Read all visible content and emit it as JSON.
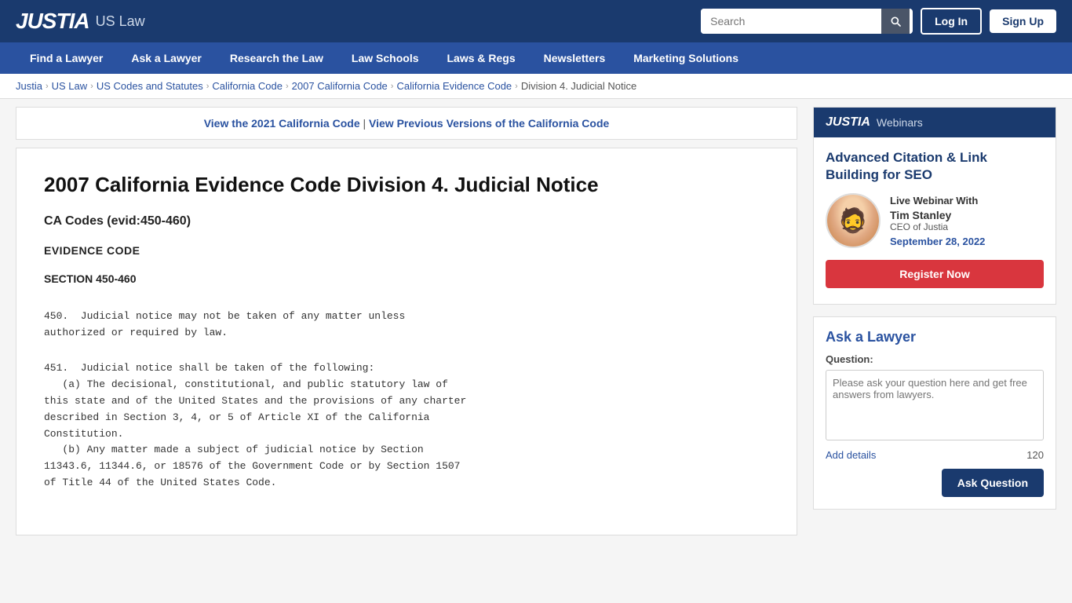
{
  "header": {
    "logo_justia": "JUSTIA",
    "logo_uslaw": "US Law",
    "search_placeholder": "Search",
    "btn_login": "Log In",
    "btn_signup": "Sign Up"
  },
  "nav": {
    "items": [
      {
        "label": "Find a Lawyer"
      },
      {
        "label": "Ask a Lawyer"
      },
      {
        "label": "Research the Law"
      },
      {
        "label": "Law Schools"
      },
      {
        "label": "Laws & Regs"
      },
      {
        "label": "Newsletters"
      },
      {
        "label": "Marketing Solutions"
      }
    ]
  },
  "breadcrumb": {
    "items": [
      {
        "label": "Justia",
        "link": true
      },
      {
        "label": "US Law",
        "link": true
      },
      {
        "label": "US Codes and Statutes",
        "link": true
      },
      {
        "label": "California Code",
        "link": true
      },
      {
        "label": "2007 California Code",
        "link": true
      },
      {
        "label": "California Evidence Code",
        "link": true
      },
      {
        "label": "Division 4. Judicial Notice",
        "link": false
      }
    ]
  },
  "view_banner": {
    "link_text": "View the 2021 California Code",
    "separator": "|",
    "link2_text": "View Previous Versions of the California Code"
  },
  "content": {
    "title": "2007 California Evidence Code Division 4. Judicial Notice",
    "subtitle": "CA Codes (evid:450-460)",
    "section_label": "EVIDENCE CODE",
    "section_number": "SECTION 450-460",
    "legal_text_1": "450.  Judicial notice may not be taken of any matter unless\nauthorized or required by law.",
    "legal_text_2": "451.  Judicial notice shall be taken of the following:\n   (a) The decisional, constitutional, and public statutory law of\nthis state and of the United States and the provisions of any charter\ndescribed in Section 3, 4, or 5 of Article XI of the California\nConstitution.\n   (b) Any matter made a subject of judicial notice by Section\n11343.6, 11344.6, or 18576 of the Government Code or by Section 1507\nof Title 44 of the United States Code."
  },
  "sidebar": {
    "webinar": {
      "logo": "JUSTIA",
      "label": "Webinars",
      "title": "Advanced Citation & Link Building for SEO",
      "live_text": "Live Webinar With",
      "speaker_name": "Tim Stanley",
      "speaker_role": "CEO of Justia",
      "date": "September 28, 2022",
      "register_btn": "Register Now"
    },
    "ask_lawyer": {
      "title": "Ask a Lawyer",
      "question_label": "Question:",
      "question_placeholder": "Please ask your question here and get free answers from lawyers.",
      "add_details_link": "Add details",
      "char_count": "120",
      "ask_btn": "Ask Question"
    }
  }
}
